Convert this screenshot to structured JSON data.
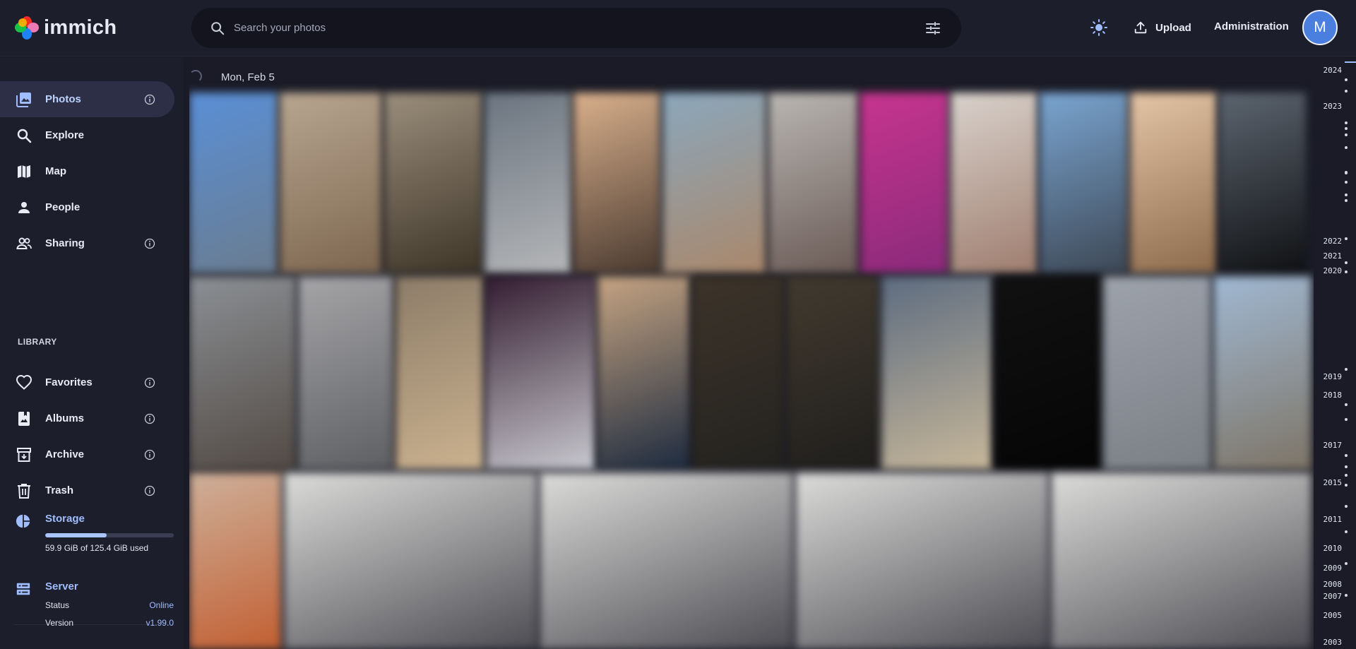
{
  "app": {
    "name": "immich"
  },
  "search": {
    "placeholder": "Search your photos"
  },
  "header": {
    "upload_label": "Upload",
    "admin_label": "Administration",
    "avatar_initial": "M"
  },
  "sidebar": {
    "items": [
      {
        "label": "Photos",
        "icon": "photos-icon",
        "active": true,
        "info": true
      },
      {
        "label": "Explore",
        "icon": "search-icon",
        "active": false,
        "info": false
      },
      {
        "label": "Map",
        "icon": "map-icon",
        "active": false,
        "info": false
      },
      {
        "label": "People",
        "icon": "person-icon",
        "active": false,
        "info": false
      },
      {
        "label": "Sharing",
        "icon": "sharing-icon",
        "active": false,
        "info": true
      }
    ],
    "library_label": "LIBRARY",
    "library_items": [
      {
        "label": "Favorites",
        "icon": "heart-icon",
        "info": true
      },
      {
        "label": "Albums",
        "icon": "album-icon",
        "info": true
      },
      {
        "label": "Archive",
        "icon": "archive-icon",
        "info": true
      },
      {
        "label": "Trash",
        "icon": "trash-icon",
        "info": true
      }
    ],
    "storage": {
      "title": "Storage",
      "usage_text": "59.9 GiB of 125.4 GiB used",
      "used_fraction": 0.478
    },
    "server": {
      "title": "Server",
      "status_label": "Status",
      "status_value": "Online",
      "version_label": "Version",
      "version_value": "v1.99.0"
    }
  },
  "timeline": {
    "date_label": "Mon, Feb 5"
  },
  "scrubber": {
    "years": [
      "2024",
      "2023",
      "2022",
      "2021",
      "2020",
      "2019",
      "2018",
      "2017",
      "2015",
      "2011",
      "2010",
      "2009",
      "2008",
      "2007",
      "2005",
      "2003"
    ]
  },
  "colors": {
    "accent": "#9fbdff",
    "background": "#1a1b26",
    "surface": "#1d1e2b",
    "avatar": "#4a7fe0"
  }
}
